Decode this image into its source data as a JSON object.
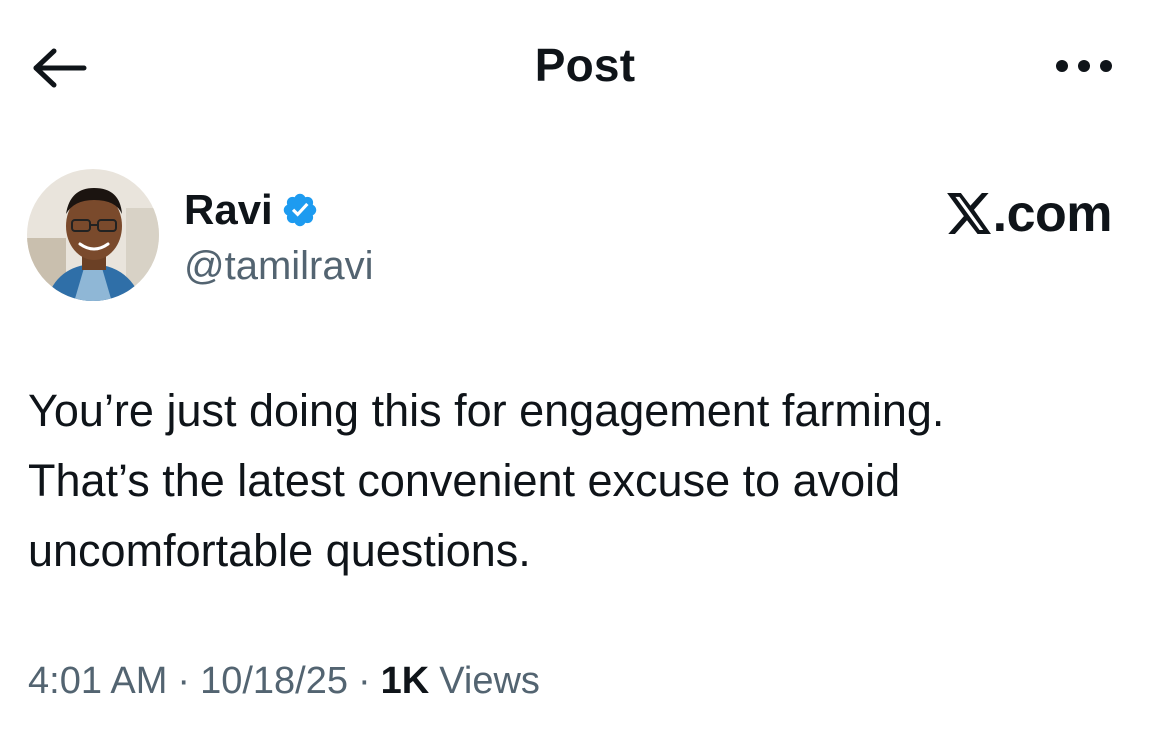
{
  "header": {
    "title": "Post",
    "back_icon": "arrow-left-icon",
    "more_icon": "more-horizontal-icon"
  },
  "author": {
    "display_name": "Ravi",
    "handle": "@tamilravi",
    "verified": true,
    "verified_color": "#1d9bf0"
  },
  "watermark": {
    "logo_letter": "𝕏",
    "suffix": ".com"
  },
  "post": {
    "text": "You’re just doing this for engagement farming.\nThat’s the latest convenient excuse to avoid\nuncomfortable questions."
  },
  "meta": {
    "time": "4:01 AM",
    "separator": "·",
    "date": "10/18/25",
    "views_count": "1K",
    "views_label": "Views"
  },
  "colors": {
    "text_primary": "#0f1419",
    "text_secondary": "#536471",
    "accent": "#1d9bf0"
  }
}
